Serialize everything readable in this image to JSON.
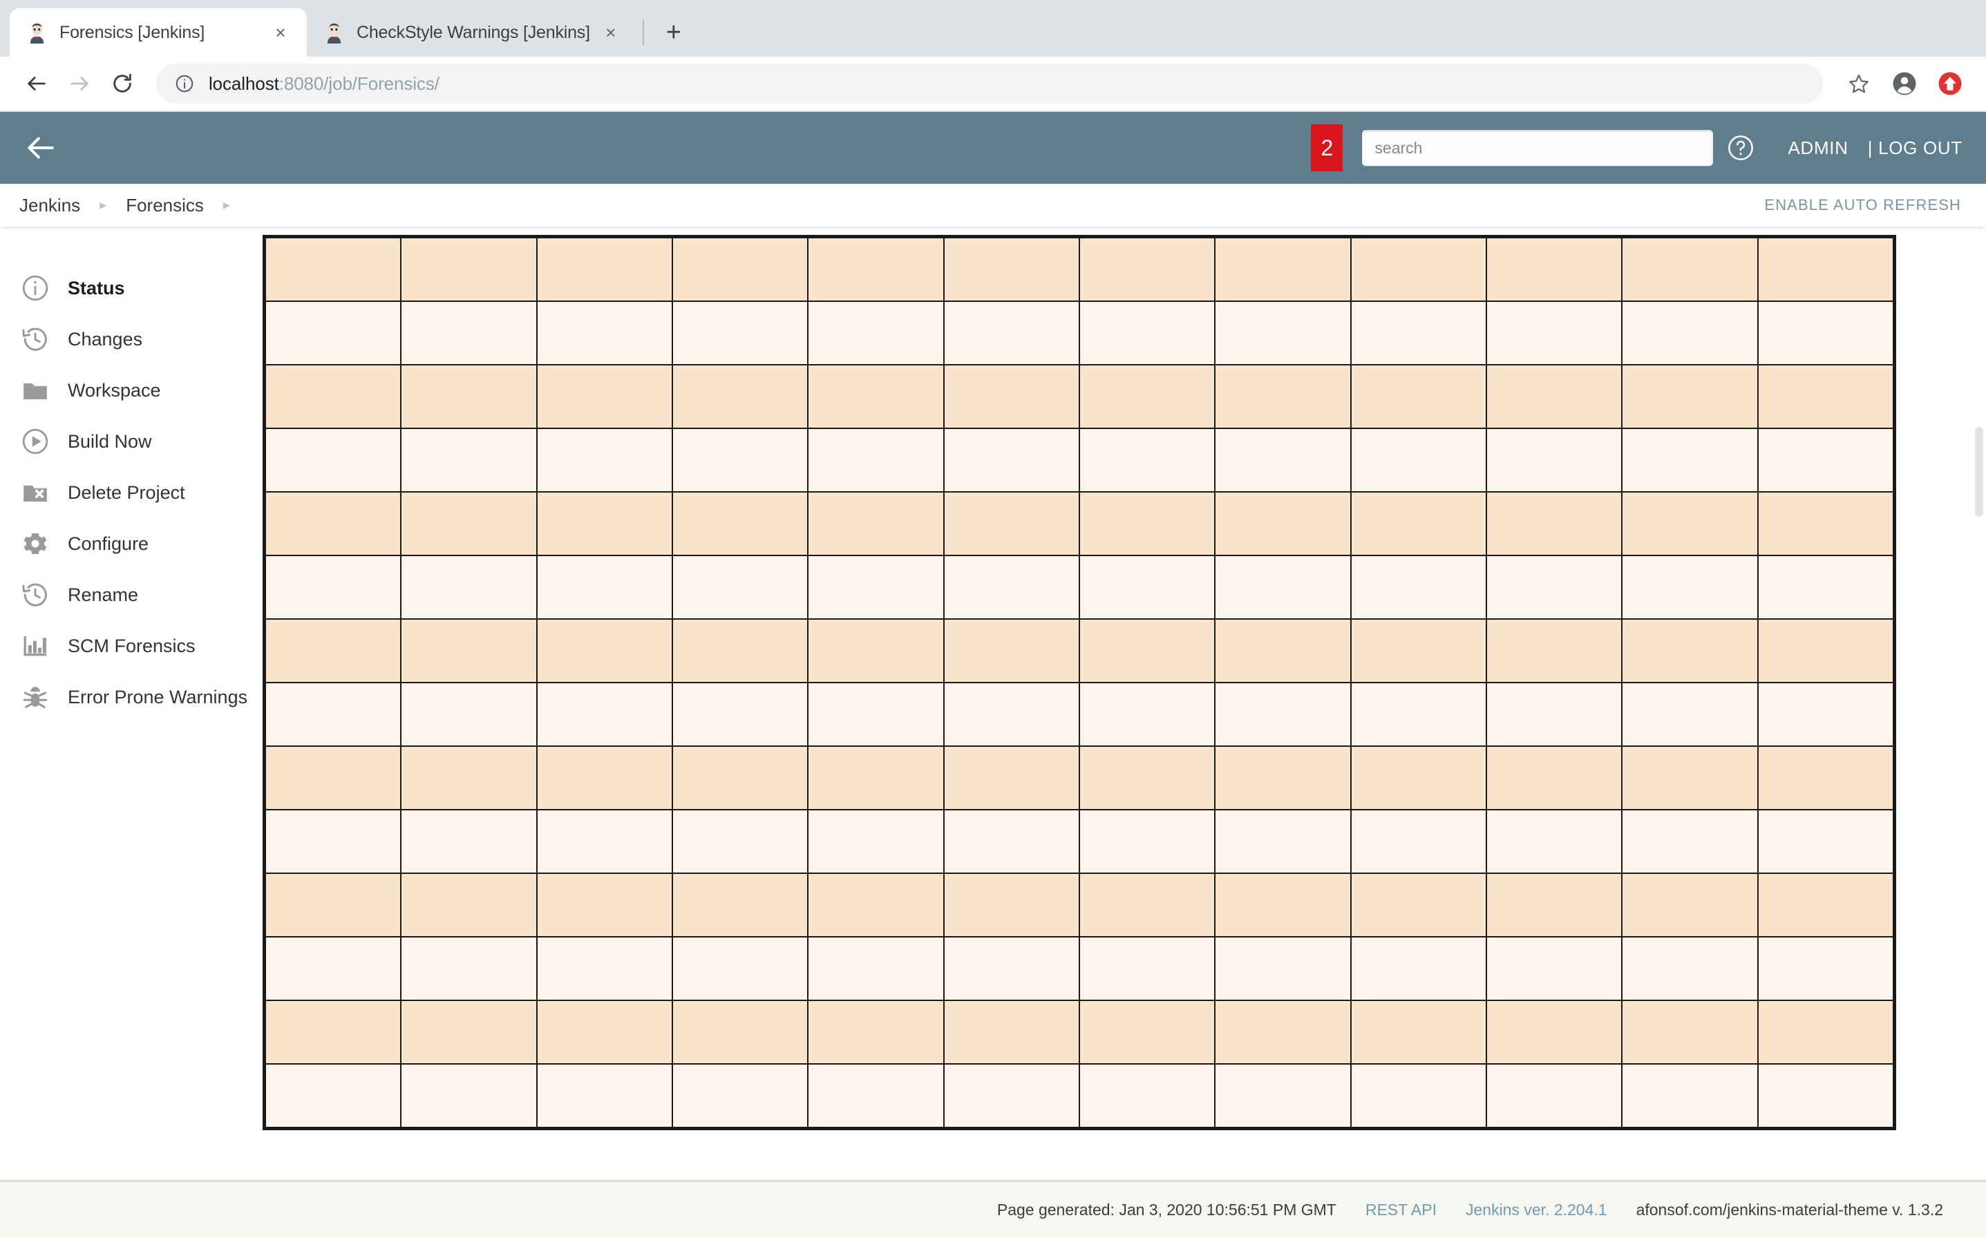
{
  "browser": {
    "tabs": [
      {
        "title": "Forensics [Jenkins]",
        "active": true,
        "favicon": "jenkins-favicon",
        "close_label": "×"
      },
      {
        "title": "CheckStyle Warnings [Jenkins]",
        "active": false,
        "favicon": "jenkins-favicon",
        "close_label": "×"
      }
    ],
    "new_tab_label": "+",
    "url_host": "localhost",
    "url_path": ":8080/job/Forensics/",
    "url_full": "localhost:8080/job/Forensics/",
    "icons": {
      "back": "back-arrow-icon",
      "forward": "forward-arrow-icon",
      "reload": "reload-icon",
      "site_info": "info-circle-icon",
      "bookmark": "star-icon",
      "profile": "profile-avatar-icon",
      "update": "update-arrow-icon"
    }
  },
  "header": {
    "back_icon": "back-arrow-icon",
    "badge_count": "2",
    "search_placeholder": "search",
    "search_value": "",
    "help_icon": "question-mark-circle-icon",
    "user_label": "ADMIN",
    "logout_label": "| LOG OUT",
    "background_color": "#5f7d8c",
    "badge_color": "#d6161b"
  },
  "breadcrumb": {
    "items": [
      {
        "label": "Jenkins"
      },
      {
        "label": "Forensics"
      }
    ],
    "separator": "▸",
    "auto_refresh_label": "ENABLE AUTO REFRESH"
  },
  "sidebar": {
    "items": [
      {
        "label": "Status",
        "icon": "info-circle-icon",
        "active": true
      },
      {
        "label": "Changes",
        "icon": "history-clock-icon",
        "active": false
      },
      {
        "label": "Workspace",
        "icon": "folder-icon",
        "active": false
      },
      {
        "label": "Build Now",
        "icon": "play-circle-icon",
        "active": false
      },
      {
        "label": "Delete Project",
        "icon": "folder-delete-icon",
        "active": false
      },
      {
        "label": "Configure",
        "icon": "gear-icon",
        "active": false
      },
      {
        "label": "Rename",
        "icon": "history-clock-icon",
        "active": false
      },
      {
        "label": "SCM Forensics",
        "icon": "bar-chart-icon",
        "active": false
      },
      {
        "label": "Error Prone Warnings",
        "icon": "bug-icon",
        "active": false
      }
    ]
  },
  "main": {
    "grid": {
      "columns": 12,
      "rows": 14,
      "odd_row_color": "#fae3cb",
      "even_row_color": "#fdf4ec",
      "border_color": "#191919",
      "cells": []
    }
  },
  "footer": {
    "generated_label": "Page generated: Jan 3, 2020 10:56:51 PM GMT",
    "rest_api_label": "REST API",
    "jenkins_version_label": "Jenkins ver. 2.204.1",
    "theme_label": "afonsof.com/jenkins-material-theme v. 1.3.2",
    "link_color": "#7599ad"
  }
}
